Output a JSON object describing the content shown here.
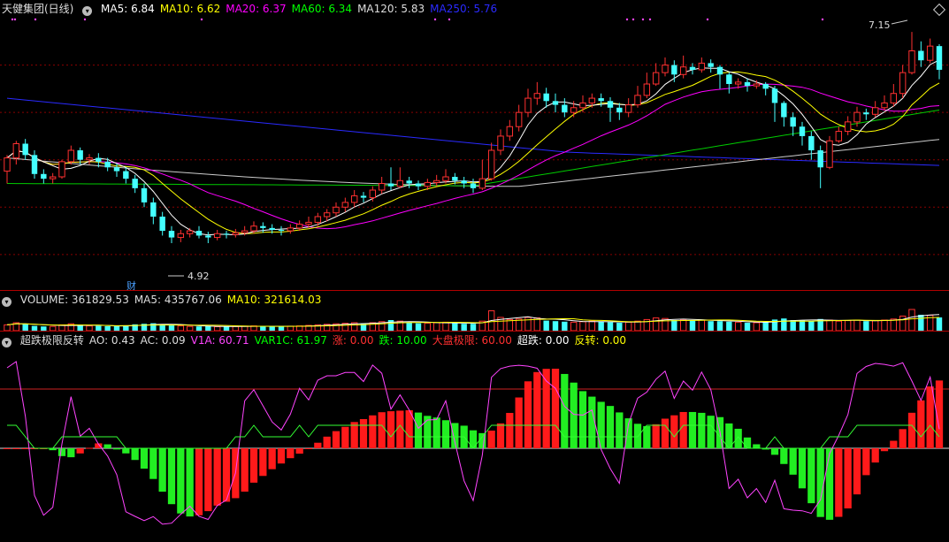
{
  "header": {
    "stock_name": "天健集团(日线)",
    "ma": [
      {
        "label": "MA5: 6.84",
        "color": "#ffffff"
      },
      {
        "label": "MA10: 6.62",
        "color": "#ffff00"
      },
      {
        "label": "MA20: 6.37",
        "color": "#ff00ff"
      },
      {
        "label": "MA60: 6.34",
        "color": "#00ff00"
      },
      {
        "label": "MA120: 5.83",
        "color": "#dddddd"
      },
      {
        "label": "MA250: 5.76",
        "color": "#2a2aff"
      }
    ],
    "high_label": "7.15",
    "low_label": "4.92",
    "cai_label": "财"
  },
  "volume_header": [
    {
      "label": "VOLUME: 361829.53",
      "color": "#dddddd"
    },
    {
      "label": "MA5: 435767.06",
      "color": "#dddddd"
    },
    {
      "label": "MA10: 321614.03",
      "color": "#ffff00"
    }
  ],
  "indicator_header": [
    {
      "label": "超跌极限反转",
      "color": "#dddddd"
    },
    {
      "label": "AO: 0.43",
      "color": "#dddddd"
    },
    {
      "label": "AC: 0.09",
      "color": "#dddddd"
    },
    {
      "label": "V1A: 60.71",
      "color": "#ff44ff"
    },
    {
      "label": "VAR1C: 61.97",
      "color": "#00ff00"
    },
    {
      "label": "涨: 0.00",
      "color": "#ff3030"
    },
    {
      "label": "跌: 10.00",
      "color": "#00ff00"
    },
    {
      "label": "大盘极限: 60.00",
      "color": "#ff3030"
    },
    {
      "label": "超跌: 0.00",
      "color": "#ffffff"
    },
    {
      "label": "反转: 0.00",
      "color": "#ffff00"
    }
  ],
  "chart_data": {
    "type": "candlestick",
    "price_range": [
      4.5,
      7.3
    ],
    "candles": [
      [
        5.68,
        5.82,
        5.85,
        5.55
      ],
      [
        5.82,
        5.97,
        6.0,
        5.75
      ],
      [
        5.97,
        5.85,
        6.02,
        5.8
      ],
      [
        5.85,
        5.65,
        5.9,
        5.6
      ],
      [
        5.65,
        5.6,
        5.7,
        5.55
      ],
      [
        5.6,
        5.62,
        5.66,
        5.55
      ],
      [
        5.62,
        5.78,
        5.8,
        5.6
      ],
      [
        5.78,
        5.9,
        5.95,
        5.75
      ],
      [
        5.9,
        5.8,
        5.93,
        5.75
      ],
      [
        5.8,
        5.82,
        5.86,
        5.75
      ],
      [
        5.82,
        5.78,
        5.87,
        5.72
      ],
      [
        5.78,
        5.72,
        5.82,
        5.68
      ],
      [
        5.72,
        5.68,
        5.76,
        5.62
      ],
      [
        5.68,
        5.6,
        5.72,
        5.55
      ],
      [
        5.6,
        5.5,
        5.64,
        5.45
      ],
      [
        5.5,
        5.35,
        5.55,
        5.3
      ],
      [
        5.35,
        5.2,
        5.4,
        5.12
      ],
      [
        5.2,
        5.05,
        5.25,
        5.0
      ],
      [
        5.05,
        4.98,
        5.1,
        4.92
      ],
      [
        4.98,
        5.02,
        5.06,
        4.93
      ],
      [
        5.02,
        5.05,
        5.08,
        4.98
      ],
      [
        5.05,
        5.0,
        5.1,
        4.97
      ],
      [
        5.0,
        4.98,
        5.04,
        4.92
      ],
      [
        4.98,
        5.02,
        5.06,
        4.95
      ],
      [
        5.02,
        5.01,
        5.05,
        4.97
      ],
      [
        5.01,
        5.03,
        5.07,
        4.98
      ],
      [
        5.03,
        5.05,
        5.1,
        5.0
      ],
      [
        5.05,
        5.1,
        5.15,
        5.02
      ],
      [
        5.1,
        5.08,
        5.14,
        5.03
      ],
      [
        5.08,
        5.06,
        5.12,
        5.02
      ],
      [
        5.06,
        5.05,
        5.1,
        5.0
      ],
      [
        5.05,
        5.08,
        5.12,
        5.02
      ],
      [
        5.08,
        5.12,
        5.16,
        5.05
      ],
      [
        5.12,
        5.14,
        5.2,
        5.08
      ],
      [
        5.14,
        5.2,
        5.24,
        5.1
      ],
      [
        5.2,
        5.24,
        5.28,
        5.15
      ],
      [
        5.24,
        5.3,
        5.35,
        5.2
      ],
      [
        5.3,
        5.35,
        5.4,
        5.25
      ],
      [
        5.35,
        5.42,
        5.48,
        5.3
      ],
      [
        5.42,
        5.4,
        5.46,
        5.35
      ],
      [
        5.4,
        5.48,
        5.52,
        5.36
      ],
      [
        5.48,
        5.55,
        5.62,
        5.44
      ],
      [
        5.55,
        5.52,
        5.72,
        5.48
      ],
      [
        5.52,
        5.58,
        5.72,
        5.5
      ],
      [
        5.58,
        5.55,
        5.62,
        5.5
      ],
      [
        5.55,
        5.52,
        5.58,
        5.48
      ],
      [
        5.52,
        5.56,
        5.6,
        5.48
      ],
      [
        5.56,
        5.58,
        5.64,
        5.52
      ],
      [
        5.58,
        5.62,
        5.7,
        5.55
      ],
      [
        5.62,
        5.58,
        5.66,
        5.54
      ],
      [
        5.58,
        5.55,
        5.62,
        5.5
      ],
      [
        5.55,
        5.5,
        5.6,
        5.45
      ],
      [
        5.5,
        5.6,
        5.8,
        5.48
      ],
      [
        5.6,
        5.9,
        5.98,
        5.58
      ],
      [
        5.9,
        6.05,
        6.12,
        5.85
      ],
      [
        6.05,
        6.15,
        6.22,
        6.0
      ],
      [
        6.15,
        6.3,
        6.38,
        6.1
      ],
      [
        6.3,
        6.45,
        6.55,
        6.25
      ],
      [
        6.45,
        6.5,
        6.62,
        6.38
      ],
      [
        6.5,
        6.42,
        6.56,
        6.35
      ],
      [
        6.42,
        6.38,
        6.5,
        6.3
      ],
      [
        6.38,
        6.3,
        6.45,
        6.25
      ],
      [
        6.3,
        6.35,
        6.42,
        6.25
      ],
      [
        6.35,
        6.4,
        6.48,
        6.3
      ],
      [
        6.4,
        6.45,
        6.5,
        6.35
      ],
      [
        6.45,
        6.42,
        6.5,
        6.36
      ],
      [
        6.42,
        6.35,
        6.46,
        6.2
      ],
      [
        6.35,
        6.3,
        6.4,
        6.22
      ],
      [
        6.3,
        6.38,
        6.45,
        6.25
      ],
      [
        6.38,
        6.48,
        6.58,
        6.35
      ],
      [
        6.48,
        6.6,
        6.72,
        6.45
      ],
      [
        6.6,
        6.72,
        6.82,
        6.58
      ],
      [
        6.72,
        6.8,
        6.88,
        6.68
      ],
      [
        6.8,
        6.7,
        6.85,
        6.62
      ],
      [
        6.7,
        6.78,
        6.9,
        6.66
      ],
      [
        6.78,
        6.75,
        6.82,
        6.7
      ],
      [
        6.75,
        6.82,
        6.88,
        6.72
      ],
      [
        6.82,
        6.78,
        6.86,
        6.72
      ],
      [
        6.78,
        6.7,
        6.8,
        6.55
      ],
      [
        6.7,
        6.6,
        6.72,
        6.5
      ],
      [
        6.6,
        6.62,
        6.66,
        6.55
      ],
      [
        6.62,
        6.58,
        6.66,
        6.52
      ],
      [
        6.58,
        6.6,
        6.64,
        6.55
      ],
      [
        6.6,
        6.55,
        6.62,
        6.48
      ],
      [
        6.55,
        6.4,
        6.58,
        6.2
      ],
      [
        6.4,
        6.25,
        6.42,
        6.15
      ],
      [
        6.25,
        6.15,
        6.3,
        6.05
      ],
      [
        6.15,
        6.05,
        6.2,
        5.95
      ],
      [
        6.05,
        5.9,
        6.1,
        5.8
      ],
      [
        5.9,
        5.72,
        5.95,
        5.5
      ],
      [
        5.72,
        6.0,
        6.05,
        5.7
      ],
      [
        6.0,
        6.1,
        6.15,
        5.98
      ],
      [
        6.1,
        6.2,
        6.26,
        6.06
      ],
      [
        6.2,
        6.3,
        6.36,
        6.15
      ],
      [
        6.3,
        6.28,
        6.34,
        6.22
      ],
      [
        6.28,
        6.35,
        6.42,
        6.25
      ],
      [
        6.35,
        6.4,
        6.48,
        6.32
      ],
      [
        6.4,
        6.5,
        6.6,
        6.36
      ],
      [
        6.5,
        6.72,
        6.8,
        6.45
      ],
      [
        6.72,
        6.95,
        7.15,
        6.7
      ],
      [
        6.95,
        6.85,
        7.05,
        6.78
      ],
      [
        6.85,
        7.0,
        7.08,
        6.82
      ],
      [
        7.0,
        6.75,
        7.02,
        6.65
      ]
    ],
    "volume": [
      0.22,
      0.3,
      0.26,
      0.18,
      0.16,
      0.16,
      0.22,
      0.26,
      0.2,
      0.18,
      0.18,
      0.17,
      0.17,
      0.2,
      0.24,
      0.26,
      0.28,
      0.24,
      0.2,
      0.18,
      0.16,
      0.16,
      0.17,
      0.15,
      0.15,
      0.16,
      0.17,
      0.18,
      0.17,
      0.16,
      0.16,
      0.17,
      0.18,
      0.2,
      0.22,
      0.24,
      0.26,
      0.28,
      0.3,
      0.26,
      0.3,
      0.34,
      0.4,
      0.36,
      0.3,
      0.28,
      0.28,
      0.3,
      0.32,
      0.28,
      0.26,
      0.26,
      0.36,
      0.75,
      0.5,
      0.42,
      0.44,
      0.5,
      0.48,
      0.38,
      0.36,
      0.34,
      0.32,
      0.34,
      0.36,
      0.34,
      0.32,
      0.3,
      0.32,
      0.36,
      0.42,
      0.48,
      0.46,
      0.4,
      0.42,
      0.38,
      0.4,
      0.36,
      0.36,
      0.34,
      0.32,
      0.3,
      0.3,
      0.32,
      0.42,
      0.46,
      0.4,
      0.38,
      0.36,
      0.44,
      0.4,
      0.36,
      0.38,
      0.4,
      0.36,
      0.38,
      0.4,
      0.44,
      0.55,
      0.8,
      0.6,
      0.58,
      0.5
    ],
    "price_ticks": [
      6.8,
      6.3,
      5.8,
      5.3,
      4.8
    ],
    "indicator_range": [
      -100,
      100
    ],
    "ao_note": "histogram",
    "ac_note": "red_green"
  }
}
